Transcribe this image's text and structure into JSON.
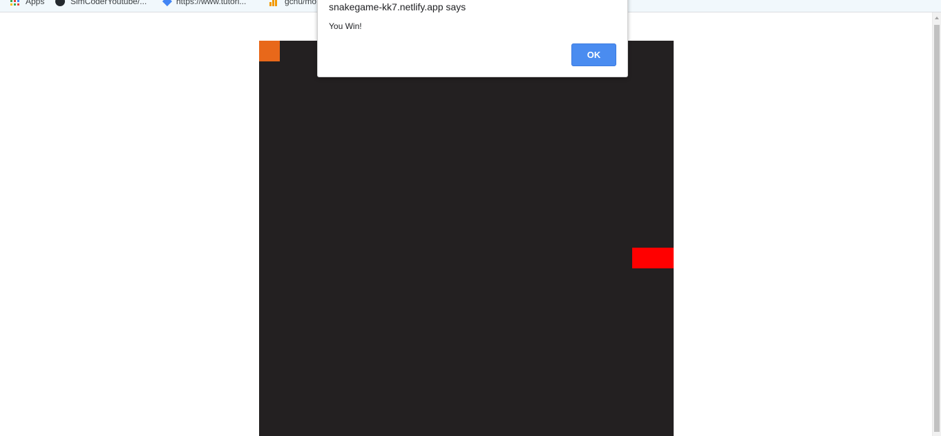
{
  "bookmarks": [
    {
      "label": "Apps",
      "icon": "apps-grid-icon"
    },
    {
      "label": "SimCoderYoutube/...",
      "icon": "github-icon"
    },
    {
      "label": "https://www.tutori...",
      "icon": "bookmark-diamond-icon"
    },
    {
      "label": "gcnu/mo",
      "icon": "bar-chart-icon"
    }
  ],
  "dialog": {
    "title": "snakegame-kk7.netlify.app says",
    "message": "You Win!",
    "ok_label": "OK"
  },
  "game": {
    "grid_size": 20,
    "colors": {
      "board": "#232021",
      "snake": "#e8681a",
      "food": "#ff0000"
    },
    "snake_cells": [
      [
        0,
        0
      ]
    ],
    "food_cells": [
      [
        18,
        10
      ],
      [
        19,
        10
      ]
    ]
  },
  "colors": {
    "ok_button": "#4a8cf0",
    "bookmarks_bar": "#f1f8fc"
  }
}
